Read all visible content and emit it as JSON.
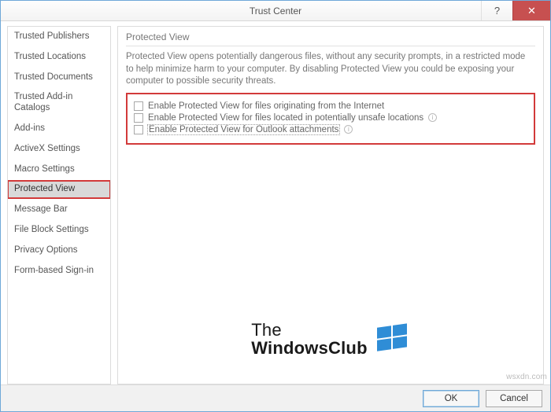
{
  "window": {
    "title": "Trust Center",
    "help_glyph": "?",
    "close_glyph": "✕"
  },
  "sidebar": {
    "items": [
      {
        "label": "Trusted Publishers",
        "selected": false
      },
      {
        "label": "Trusted Locations",
        "selected": false
      },
      {
        "label": "Trusted Documents",
        "selected": false
      },
      {
        "label": "Trusted Add-in Catalogs",
        "selected": false
      },
      {
        "label": "Add-ins",
        "selected": false
      },
      {
        "label": "ActiveX Settings",
        "selected": false
      },
      {
        "label": "Macro Settings",
        "selected": false
      },
      {
        "label": "Protected View",
        "selected": true
      },
      {
        "label": "Message Bar",
        "selected": false
      },
      {
        "label": "File Block Settings",
        "selected": false
      },
      {
        "label": "Privacy Options",
        "selected": false
      },
      {
        "label": "Form-based Sign-in",
        "selected": false
      }
    ]
  },
  "main": {
    "section_title": "Protected View",
    "description": "Protected View opens potentially dangerous files, without any security prompts, in a restricted mode to help minimize harm to your computer. By disabling Protected View you could be exposing your computer to possible security threats.",
    "options": [
      {
        "label": "Enable Protected View for files originating from the Internet",
        "checked": false,
        "has_info": false,
        "focused": false
      },
      {
        "label": "Enable Protected View for files located in potentially unsafe locations",
        "checked": false,
        "has_info": true,
        "focused": false
      },
      {
        "label": "Enable Protected View for Outlook attachments",
        "checked": false,
        "has_info": true,
        "focused": true
      }
    ]
  },
  "footer": {
    "ok_label": "OK",
    "cancel_label": "Cancel"
  },
  "watermark": {
    "line1": "The",
    "line2": "WindowsClub"
  },
  "source_tag": "wsxdn.com"
}
